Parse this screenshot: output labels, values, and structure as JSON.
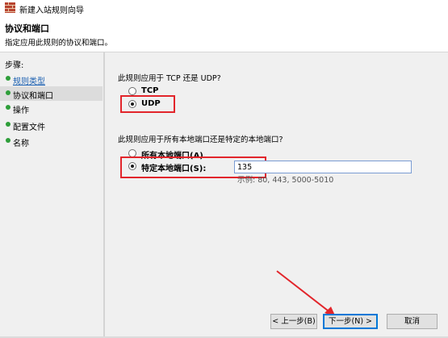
{
  "window": {
    "title": "新建入站规则向导"
  },
  "header": {
    "title": "协议和端口",
    "subtitle": "指定应用此规则的协议和端口。"
  },
  "sidebar": {
    "steps_label": "步骤:",
    "items": [
      {
        "label": "规则类型",
        "dot_color": "#2e9e3a"
      },
      {
        "label": "协议和端口",
        "dot_color": "#2e9e3a"
      },
      {
        "label": "操作",
        "dot_color": "#2e9e3a"
      },
      {
        "label": "配置文件",
        "dot_color": "#2e9e3a"
      },
      {
        "label": "名称",
        "dot_color": "#2e9e3a"
      }
    ]
  },
  "protocol": {
    "question": "此规则应用于 TCP 还是 UDP?",
    "options": [
      "TCP",
      "UDP"
    ],
    "selected": "UDP"
  },
  "ports": {
    "question": "此规则应用于所有本地端口还是特定的本地端口?",
    "options": [
      "所有本地端口(A)",
      "特定本地端口(S):"
    ],
    "selected": "特定本地端口(S):",
    "value": "135",
    "example": "示例: 80, 443, 5000-5010"
  },
  "buttons": {
    "back": "< 上一步(B)",
    "next": "下一步(N) >",
    "cancel": "取消"
  },
  "colors": {
    "highlight": "#e2252b",
    "accent": "#0078d7"
  }
}
